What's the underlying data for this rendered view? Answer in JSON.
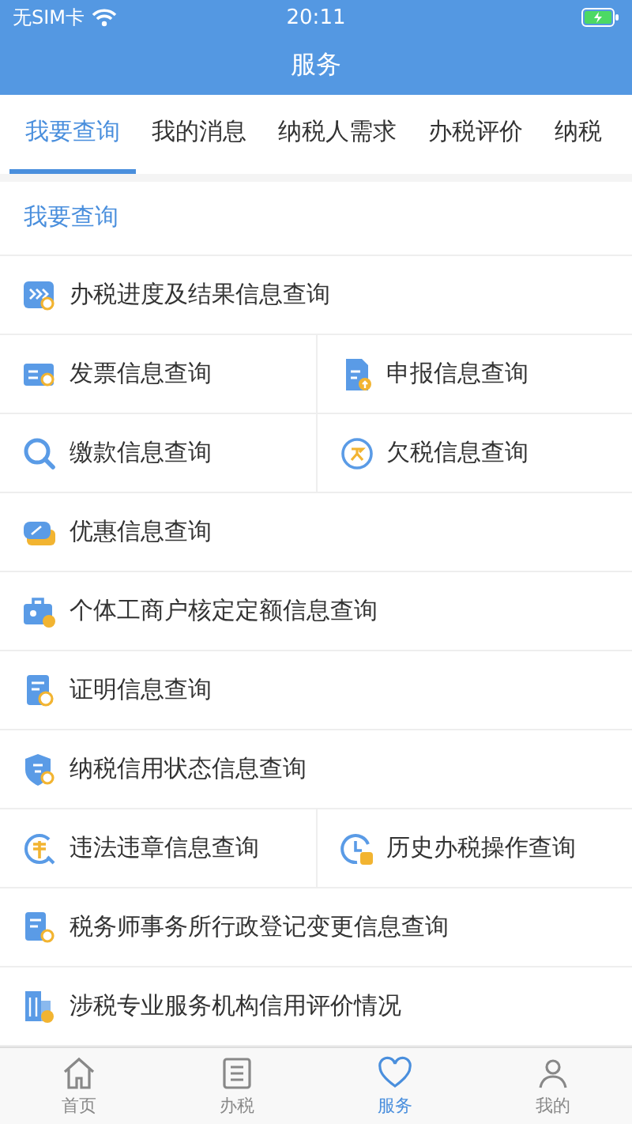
{
  "status_bar": {
    "carrier": "无SIM卡",
    "time": "20:11"
  },
  "header": {
    "title": "服务"
  },
  "tabs": [
    {
      "label": "我要查询",
      "selected": true
    },
    {
      "label": "我的消息",
      "selected": false
    },
    {
      "label": "纳税人需求",
      "selected": false
    },
    {
      "label": "办税评价",
      "selected": false
    },
    {
      "label": "纳税",
      "selected": false
    }
  ],
  "section": {
    "title": "我要查询"
  },
  "rows": [
    [
      {
        "label": "办税进度及结果信息查询",
        "kind": "progress"
      }
    ],
    [
      {
        "label": "发票信息查询",
        "kind": "invoice"
      },
      {
        "label": "申报信息查询",
        "kind": "declare"
      }
    ],
    [
      {
        "label": "缴款信息查询",
        "kind": "search"
      },
      {
        "label": "欠税信息查询",
        "kind": "owe"
      }
    ],
    [
      {
        "label": "优惠信息查询",
        "kind": "coupon"
      }
    ],
    [
      {
        "label": "个体工商户核定定额信息查询",
        "kind": "merchant"
      }
    ],
    [
      {
        "label": "证明信息查询",
        "kind": "certificate"
      }
    ],
    [
      {
        "label": "纳税信用状态信息查询",
        "kind": "shield"
      }
    ],
    [
      {
        "label": "违法违章信息查询",
        "kind": "violation"
      },
      {
        "label": "历史办税操作查询",
        "kind": "history"
      }
    ],
    [
      {
        "label": "税务师事务所行政登记变更信息查询",
        "kind": "office"
      }
    ],
    [
      {
        "label": "涉税专业服务机构信用评价情况",
        "kind": "building"
      }
    ]
  ],
  "bottom_nav": [
    {
      "label": "首页",
      "kind": "home",
      "selected": false
    },
    {
      "label": "办税",
      "kind": "list",
      "selected": false
    },
    {
      "label": "服务",
      "kind": "heart",
      "selected": true
    },
    {
      "label": "我的",
      "kind": "person",
      "selected": false
    }
  ]
}
